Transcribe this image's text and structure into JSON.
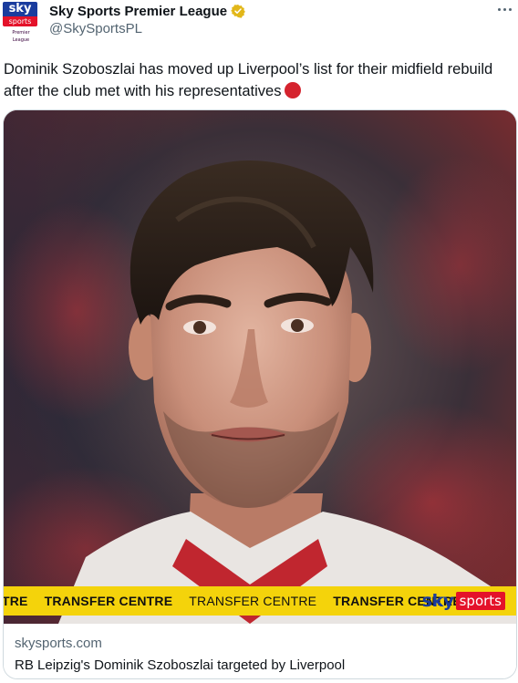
{
  "author": {
    "display_name": "Sky Sports Premier League",
    "handle": "@SkySportsPL",
    "avatar": {
      "sky": "sky",
      "sports": "sports",
      "sub": "Premier League"
    },
    "verified_icon": "verified-badge-gold"
  },
  "more_icon": "more-horizontal-icon",
  "tweet": {
    "text": "Dominik Szoboszlai has moved up Liverpool’s list for their midfield rebuild after the club met with his representatives",
    "emoji": "red-circle"
  },
  "card": {
    "transfer_bar": {
      "items": [
        "TRE",
        "TRANSFER CENTRE",
        "TRANSFER CENTRE",
        "TRANSFER CENTRE"
      ],
      "logo_sky": "sky",
      "logo_sports": "sports"
    },
    "domain": "skysports.com",
    "title": "RB Leipzig's Dominik Szoboszlai targeted by Liverpool"
  },
  "colors": {
    "sky_blue": "#1a3c9e",
    "sky_red": "#e4122a",
    "transfer_yellow": "#f4d30b",
    "secondary_text": "#536471",
    "verified_gold": "#e2b719"
  }
}
